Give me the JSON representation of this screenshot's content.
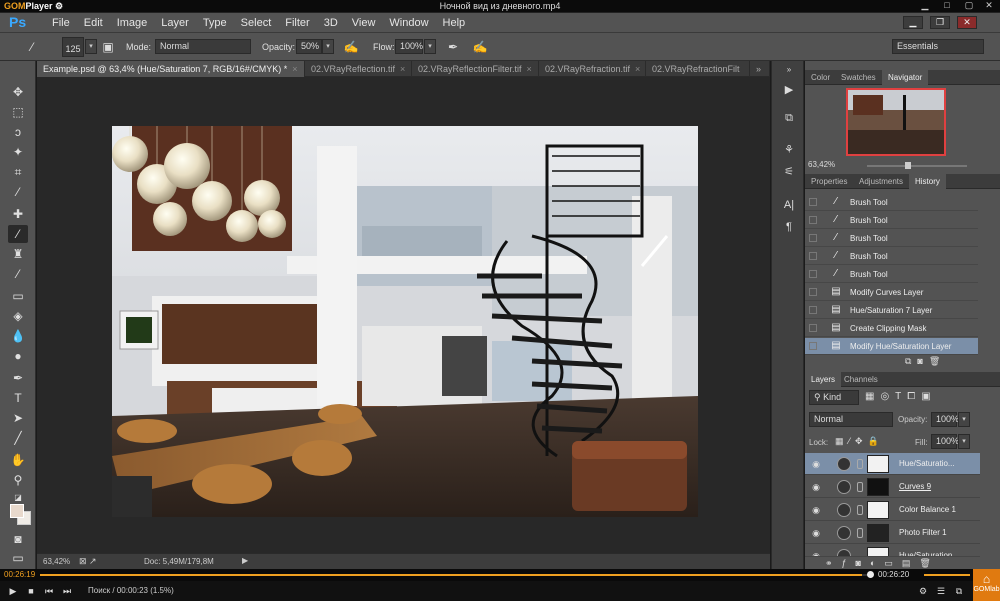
{
  "player": {
    "brand_prefix": "GOM",
    "brand_suffix": "Player",
    "title": "Ночной вид из дневного.mp4",
    "elapsed": "00:26:19",
    "total": "00:26:20",
    "status": "Поиск / 00:00:23 (1.5%)",
    "progress": 0.99,
    "gomlab_label": "GOMlab"
  },
  "ps": {
    "logo": "Ps",
    "menu": [
      "File",
      "Edit",
      "Image",
      "Layer",
      "Type",
      "Select",
      "Filter",
      "3D",
      "View",
      "Window",
      "Help"
    ],
    "options": {
      "brush_size": "125",
      "mode_label": "Mode:",
      "mode_value": "Normal",
      "opacity_label": "Opacity:",
      "opacity_value": "50%",
      "flow_label": "Flow:",
      "flow_value": "100%",
      "workspace": "Essentials"
    },
    "tabs": [
      "Example.psd @ 63,4% (Hue/Saturation 7, RGB/16#/CMYK) *",
      "02.VRayReflection.tif",
      "02.VRayReflectionFilter.tif",
      "02.VRayRefraction.tif",
      "02.VRayRefractionFilt"
    ],
    "status_zoom": "63,42%",
    "status_doc": "Doc: 5,49M/179,8M",
    "nav_tabs": [
      "Color",
      "Swatches",
      "Navigator"
    ],
    "nav_zoom": "63,42%",
    "hist_tabs": [
      "Properties",
      "Adjustments",
      "History"
    ],
    "history": [
      "Brush Tool",
      "Brush Tool",
      "Brush Tool",
      "Brush Tool",
      "Brush Tool",
      "Modify Curves Layer",
      "Hue/Saturation 7 Layer",
      "Create Clipping Mask",
      "Modify Hue/Saturation Layer"
    ],
    "layers_tabs": [
      "Layers",
      "Channels"
    ],
    "layers_kind": "Kind",
    "layers_blend": "Normal",
    "layers_opacity_label": "Opacity:",
    "layers_opacity": "100%",
    "layers_lock_label": "Lock:",
    "layers_fill_label": "Fill:",
    "layers_fill": "100%",
    "layers": [
      "Hue/Saturatio...",
      "Curves 9",
      "Color Balance 1",
      "Photo Filter 1",
      "Hue/Saturation..."
    ]
  }
}
